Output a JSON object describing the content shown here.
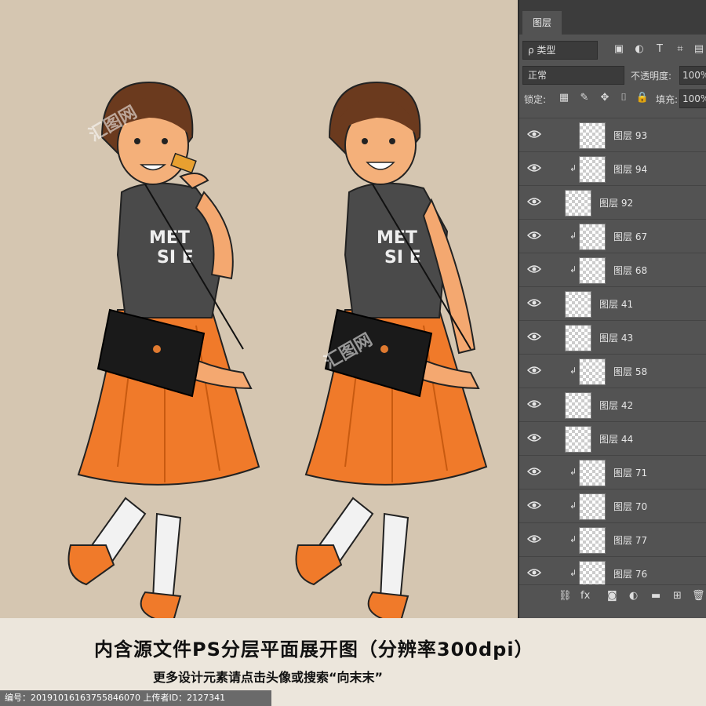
{
  "layers_panel": {
    "tab_label": "图层",
    "filter_label": "ρ 类型",
    "blend_mode": "正常",
    "opacity_label": "不透明度:",
    "opacity_value": "100%",
    "lock_label": "锁定:",
    "fill_label": "填充:",
    "fill_value": "100%",
    "layers": [
      {
        "name": "图层 93",
        "clipped": false,
        "indent": true
      },
      {
        "name": "图层 94",
        "clipped": true,
        "indent": true
      },
      {
        "name": "图层 92",
        "clipped": false,
        "indent": false
      },
      {
        "name": "图层 67",
        "clipped": true,
        "indent": true
      },
      {
        "name": "图层 68",
        "clipped": true,
        "indent": true
      },
      {
        "name": "图层 41",
        "clipped": false,
        "indent": false
      },
      {
        "name": "图层 43",
        "clipped": false,
        "indent": false
      },
      {
        "name": "图层 58",
        "clipped": true,
        "indent": true
      },
      {
        "name": "图层 42",
        "clipped": false,
        "indent": false
      },
      {
        "name": "图层 44",
        "clipped": false,
        "indent": false
      },
      {
        "name": "图层 71",
        "clipped": true,
        "indent": true
      },
      {
        "name": "图层 70",
        "clipped": true,
        "indent": true
      },
      {
        "name": "图层 77",
        "clipped": true,
        "indent": true
      },
      {
        "name": "图层 76",
        "clipped": true,
        "indent": true
      }
    ]
  },
  "banner": {
    "line1": "内含源文件PS分层平面展开图（分辨率300dpi）",
    "line2": "更多设计元素请点击头像或搜索“向末末”",
    "footer": "编号：20191016163755846070 上传者ID：2127341"
  },
  "watermark": "汇图网",
  "colors": {
    "background": "#d5c6b1",
    "skirt": "#f07a2a",
    "shirt": "#4a4a4a",
    "panel": "#535353"
  }
}
